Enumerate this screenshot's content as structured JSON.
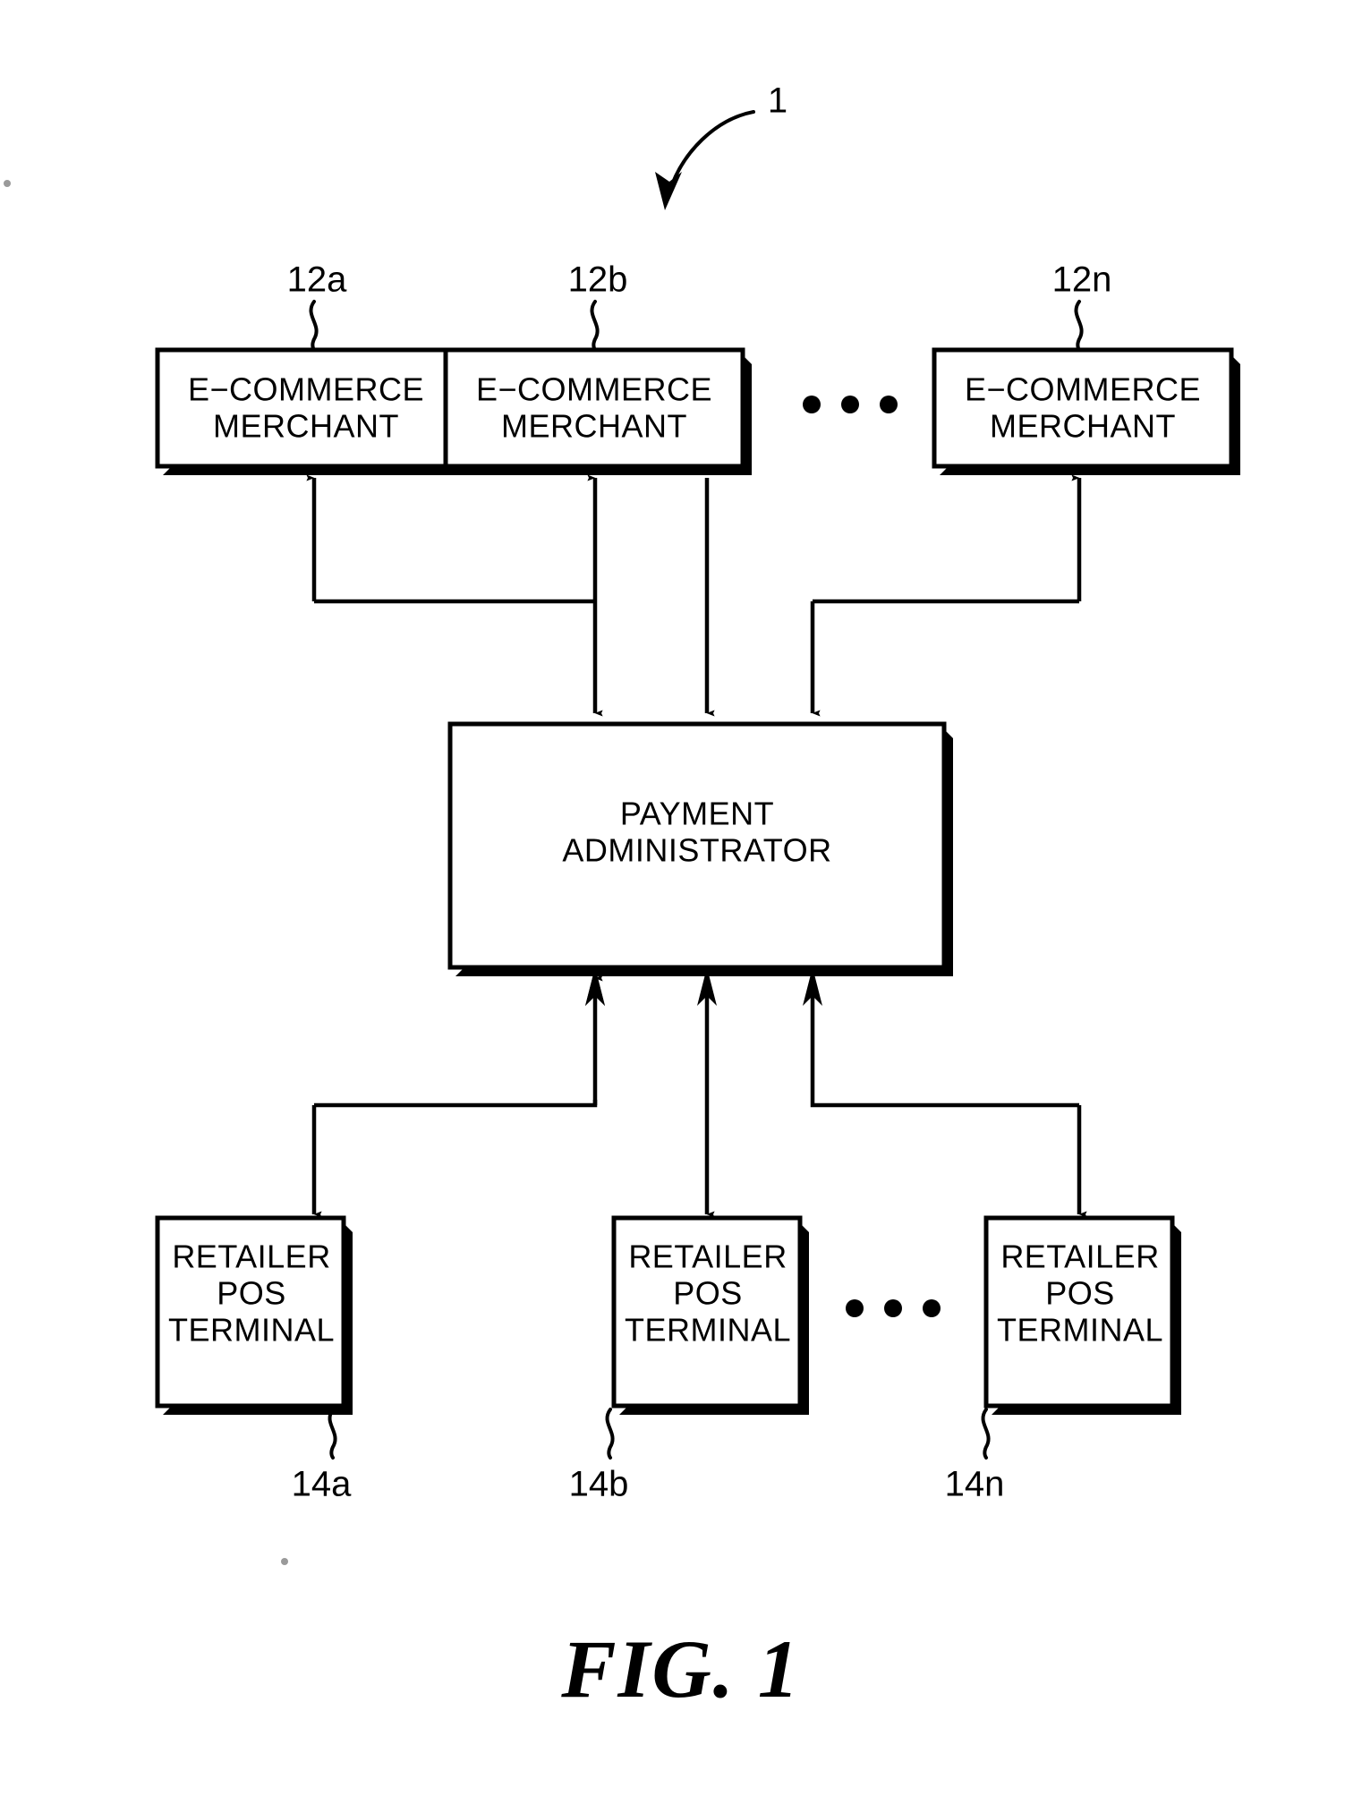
{
  "figure": {
    "caption": "FIG.  1",
    "system_ref": "1",
    "type": "block-diagram"
  },
  "nodes": {
    "merchants": [
      {
        "ref": "12a",
        "line1": "E−COMMERCE",
        "line2": "MERCHANT"
      },
      {
        "ref": "12b",
        "line1": "E−COMMERCE",
        "line2": "MERCHANT"
      },
      {
        "ref": "12n",
        "line1": "E−COMMERCE",
        "line2": "MERCHANT"
      }
    ],
    "administrator": {
      "line1": "PAYMENT",
      "line2": "ADMINISTRATOR"
    },
    "terminals": [
      {
        "ref": "14a",
        "line1": "RETAILER",
        "line2": "POS",
        "line3": "TERMINAL"
      },
      {
        "ref": "14b",
        "line1": "RETAILER",
        "line2": "POS",
        "line3": "TERMINAL"
      },
      {
        "ref": "14n",
        "line1": "RETAILER",
        "line2": "POS",
        "line3": "TERMINAL"
      }
    ]
  },
  "ellipsis": {
    "top": "• • •",
    "bottom": "• • •"
  },
  "colors": {
    "ink": "#000000",
    "paper": "#ffffff"
  }
}
